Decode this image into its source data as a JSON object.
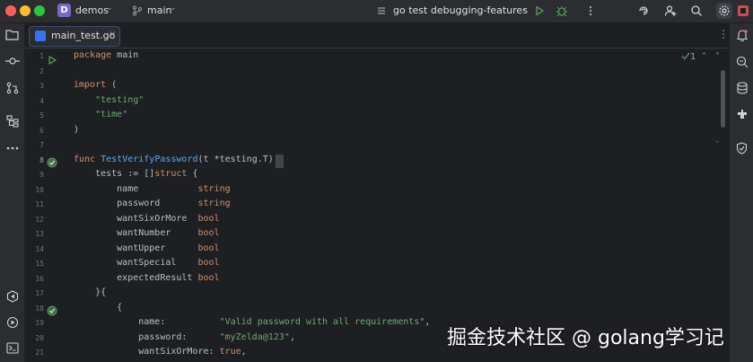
{
  "titlebar": {
    "project_badge": "D",
    "project_name": "demos",
    "branch": "main",
    "run_config": "go test debugging-features"
  },
  "tab": {
    "filename": "main_test.go"
  },
  "inspections": {
    "count": "1"
  },
  "line_numbers": [
    "1",
    "2",
    "3",
    "4",
    "5",
    "6",
    "7",
    "8",
    "9",
    "10",
    "11",
    "12",
    "13",
    "14",
    "15",
    "16",
    "17",
    "18",
    "19",
    "20",
    "21"
  ],
  "code_lines": [
    [
      {
        "t": "package ",
        "c": "kw"
      },
      {
        "t": "main",
        "c": "plain"
      }
    ],
    [],
    [
      {
        "t": "import ",
        "c": "kw"
      },
      {
        "t": "(",
        "c": "plain"
      }
    ],
    [
      {
        "t": "    ",
        "c": "plain"
      },
      {
        "t": "\"testing\"",
        "c": "str"
      }
    ],
    [
      {
        "t": "    ",
        "c": "plain"
      },
      {
        "t": "\"time\"",
        "c": "str"
      }
    ],
    [
      {
        "t": ")",
        "c": "plain"
      }
    ],
    [],
    [
      {
        "t": "func ",
        "c": "kw"
      },
      {
        "t": "TestVerifyPassword",
        "c": "fn"
      },
      {
        "t": "(t *testing.T) {",
        "c": "plain"
      }
    ],
    [
      {
        "t": "    tests := []",
        "c": "plain"
      },
      {
        "t": "struct",
        "c": "kw"
      },
      {
        "t": " {",
        "c": "plain"
      }
    ],
    [
      {
        "t": "        name           ",
        "c": "plain"
      },
      {
        "t": "string",
        "c": "kw"
      }
    ],
    [
      {
        "t": "        password       ",
        "c": "plain"
      },
      {
        "t": "string",
        "c": "kw"
      }
    ],
    [
      {
        "t": "        wantSixOrMore  ",
        "c": "plain"
      },
      {
        "t": "bool",
        "c": "kw"
      }
    ],
    [
      {
        "t": "        wantNumber     ",
        "c": "plain"
      },
      {
        "t": "bool",
        "c": "kw"
      }
    ],
    [
      {
        "t": "        wantUpper      ",
        "c": "plain"
      },
      {
        "t": "bool",
        "c": "kw"
      }
    ],
    [
      {
        "t": "        wantSpecial    ",
        "c": "plain"
      },
      {
        "t": "bool",
        "c": "kw"
      }
    ],
    [
      {
        "t": "        expectedResult ",
        "c": "plain"
      },
      {
        "t": "bool",
        "c": "kw"
      }
    ],
    [
      {
        "t": "    }{",
        "c": "plain"
      }
    ],
    [
      {
        "t": "        {",
        "c": "plain"
      }
    ],
    [
      {
        "t": "            name:          ",
        "c": "plain"
      },
      {
        "t": "\"Valid password with all requirements\"",
        "c": "str"
      },
      {
        "t": ",",
        "c": "plain"
      }
    ],
    [
      {
        "t": "            password:      ",
        "c": "plain"
      },
      {
        "t": "\"myZelda@123\"",
        "c": "str"
      },
      {
        "t": ",",
        "c": "plain"
      }
    ],
    [
      {
        "t": "            wantSixOrMore: ",
        "c": "plain"
      },
      {
        "t": "true",
        "c": "kw"
      },
      {
        "t": ",",
        "c": "plain"
      }
    ]
  ],
  "watermark": "掘金技术社区 @ golang学习记",
  "colors": {
    "background": "#1e1f22",
    "chrome": "#2b2d30",
    "keyword": "#cf8e6d",
    "string": "#6aab73",
    "function": "#56a8f5",
    "run_green": "#57965c"
  },
  "icons": {
    "left_bar": [
      "folder-icon",
      "commit-icon",
      "pull-requests-icon",
      "structure-icon",
      "more-icon",
      "services-icon",
      "run-icon",
      "terminal-icon"
    ],
    "right_bar": [
      "notifications-icon",
      "ai-assistant-icon",
      "database-icon",
      "plugins-icon",
      "problems-icon"
    ]
  }
}
